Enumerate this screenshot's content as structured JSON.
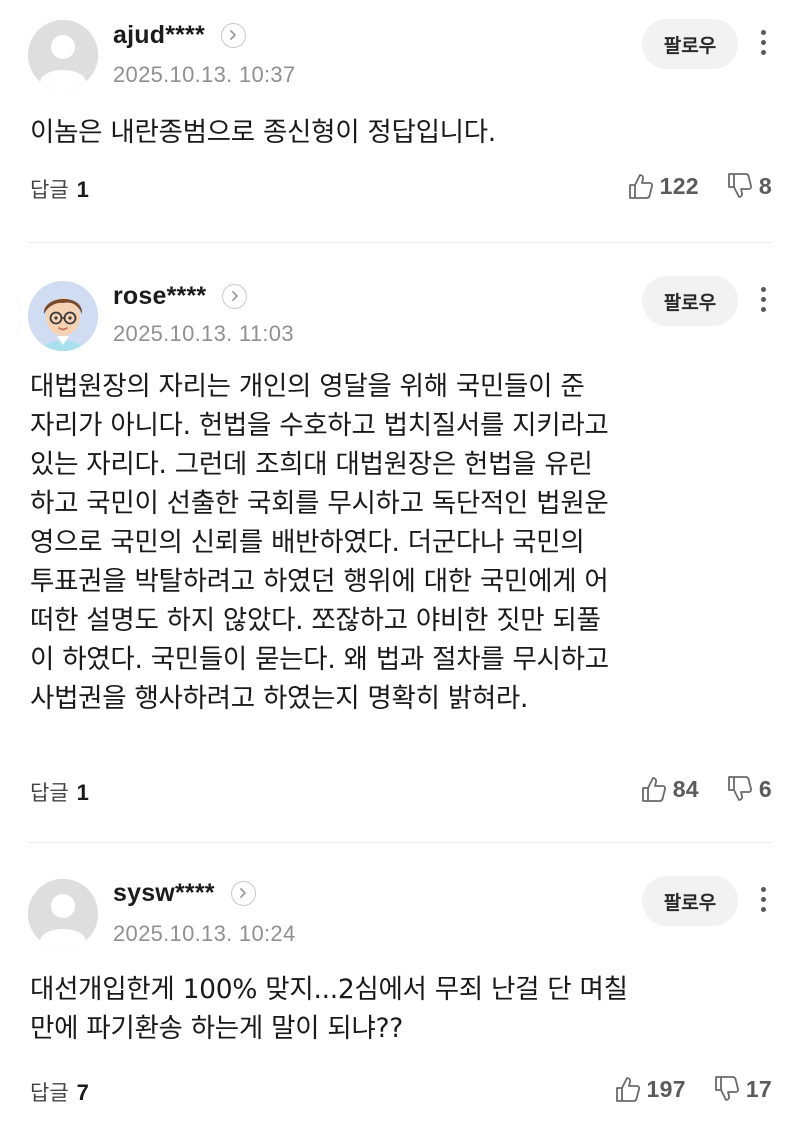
{
  "comments": [
    {
      "username": "ajud****",
      "timestamp": "2025.10.13. 10:37",
      "follow_label": "팔로우",
      "body": "이놈은 내란종범으로 종신형이 정답입니다.",
      "reply_label": "답글",
      "reply_count": "1",
      "likes": "122",
      "dislikes": "8"
    },
    {
      "username": "rose****",
      "timestamp": "2025.10.13. 11:03",
      "follow_label": "팔로우",
      "body_lines": [
        "대법원장의 자리는 개인의 영달을 위해 국민들이 준",
        "자리가 아니다. 헌법을 수호하고 법치질서를 지키라고",
        "있는 자리다. 그런데 조희대 대법원장은 헌법을 유린",
        "하고 국민이 선출한 국회를 무시하고 독단적인 법원운",
        "영으로 국민의 신뢰를 배반하였다. 더군다나 국민의",
        "투표권을 박탈하려고 하였던 행위에 대한 국민에게 어",
        "떠한 설명도 하지 않았다. 쪼잖하고 야비한 짓만 되풀",
        "이 하였다. 국민들이 묻는다. 왜 법과 절차를 무시하고",
        "사법권을 행사하려고 하였는지 명확히 밝혀라."
      ],
      "reply_label": "답글",
      "reply_count": "1",
      "likes": "84",
      "dislikes": "6"
    },
    {
      "username": "sysw****",
      "timestamp": "2025.10.13. 10:24",
      "follow_label": "팔로우",
      "body_lines": [
        "대선개입한게 100% 맞지...2심에서 무죄 난걸 단 며칠",
        "만에 파기환송 하는게 말이 되냐??"
      ],
      "reply_label": "답글",
      "reply_count": "7",
      "likes": "197",
      "dislikes": "17"
    }
  ],
  "icons": {
    "profile_link": "chevron-right-icon",
    "more": "more-vertical-icon",
    "like": "thumbs-up-icon",
    "dislike": "thumbs-down-icon"
  },
  "colors": {
    "username": "#1b1b1b",
    "timestamp": "#909090",
    "follow_bg": "#f2f2f2",
    "divider": "#ebebeb"
  }
}
